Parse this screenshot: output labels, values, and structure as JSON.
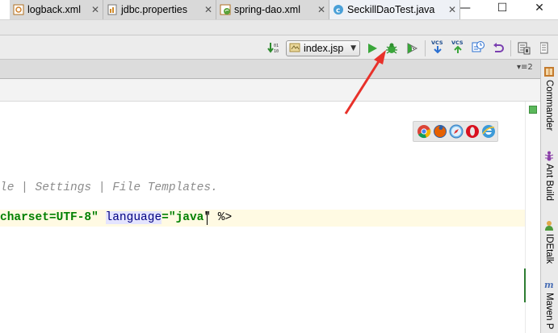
{
  "window": {
    "minimize_glyph": "—",
    "maximize_glyph": "☐",
    "close_glyph": "✕"
  },
  "toolbar": {
    "run_config_label": "index.jsp",
    "icons": [
      "sort-icon",
      "run-config-icon",
      "run-icon",
      "debug-icon",
      "coverage-icon",
      "vcs-update-icon",
      "vcs-commit-icon",
      "vcs-compare-icon",
      "vcs-revert-icon",
      "project-structure-icon"
    ]
  },
  "tabs": [
    {
      "label": "logback.xml",
      "icon": "xml-file-icon",
      "close": "✕",
      "active": false
    },
    {
      "label": "jdbc.properties",
      "icon": "properties-file-icon",
      "close": "✕",
      "active": false
    },
    {
      "label": "spring-dao.xml",
      "icon": "spring-xml-icon",
      "close": "✕",
      "active": false
    },
    {
      "label": "SeckillDaoTest.java",
      "icon": "java-class-icon",
      "close": "✕",
      "active": true
    }
  ],
  "tabs_overflow": "▾≡2",
  "editor": {
    "comment_text": "le | Settings | File Templates.",
    "directive_line": {
      "part1": "charset=UTF-8\"",
      "space": " ",
      "attr": "language",
      "eq": "=\"",
      "value": "java",
      "close": "\" %>"
    }
  },
  "browsers": [
    "chrome-icon",
    "firefox-icon",
    "safari-icon",
    "opera-icon",
    "ie-icon"
  ],
  "sidebar": {
    "items": [
      {
        "label": "Commander",
        "icon": "commander-icon"
      },
      {
        "label": "Ant Build",
        "icon": "ant-icon"
      },
      {
        "label": "IDEtalk",
        "icon": "idetalk-icon"
      },
      {
        "label": "Maven P",
        "icon": "maven-icon"
      }
    ]
  },
  "colors": {
    "run": "#3aa63a",
    "debug": "#3aa63a",
    "annotation_arrow": "#e8312a",
    "string": "#008000",
    "comment": "#8c8c8c"
  }
}
